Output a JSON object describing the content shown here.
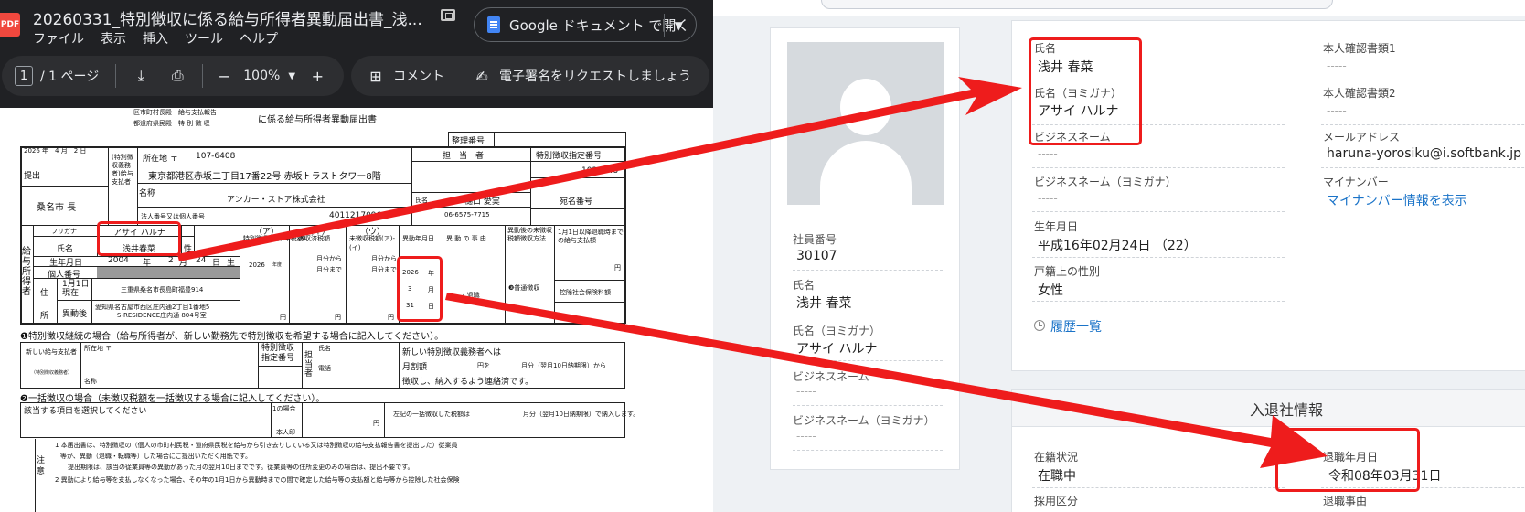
{
  "pdf_viewer": {
    "badge": "PDF",
    "title": "20260331_特別徴収に係る給与所得者異動届出書_浅...",
    "menu": [
      "ファイル",
      "表示",
      "挿入",
      "ツール",
      "ヘルプ"
    ],
    "open_with": "Google ドキュメント で開く",
    "page_current": "1",
    "page_total": "/ 1 ページ",
    "zoom": "100%",
    "comment": "コメント",
    "esign": "電子署名をリクエストしましょう"
  },
  "pdf_form": {
    "header_line1": "区市町村長殿　給与支払報告",
    "header_line2": "都道府県民殿　特 別 徴 収",
    "header_title": "に係る給与所得者異動届出書",
    "seiri_bango": "整理番号",
    "date_line": "2026 年　4 月　2 日",
    "teishutsu": "提出",
    "obligor_label": "(特別徴収義務者)給与支払者",
    "address_label": "所在地 〒",
    "postal": "107-6408",
    "address": "東京都港区赤坂二丁目17番22号 赤坂トラストタワー8階",
    "name_label": "名称",
    "company": "アンカー・ストア株式会社",
    "mayor": "桑名市 長",
    "corp_no_label": "法人番号又は個人番号",
    "corp_no": "4011217096",
    "tanto_label": "担　当　者",
    "shitei_label": "特別徴収指定番号",
    "shitei_no": "1027348",
    "tanto_name_label": "氏名",
    "tanto_name": "樋口 愛実",
    "atena_label": "宛名番号",
    "phone": "06-6575-7715",
    "furigana_label": "フリガナ",
    "furigana": "アサイ ハルナ",
    "shimei_label": "氏名",
    "shimei": "浅井春菜",
    "sex": "性",
    "birth_label": "生年月日",
    "birth_year": "2004",
    "birth_month": "2",
    "birth_day": "24",
    "nen": "年",
    "gatsu": "月",
    "nichi": "日",
    "sei": "生",
    "kojin_label": "個人番号",
    "jan1_label": "1月1日現在",
    "jan1_addr": "三重県桑名市長島町福豊914",
    "ido_label": "異動後",
    "ido_addr1": "愛知県名古屋市西区庄内通2丁目1番地5",
    "ido_addr2": "S-RESIDENCE庄内通 804号室",
    "ju": "住",
    "sho": "所",
    "kyuyo_label": "給与所得者",
    "col_a": "（ア）",
    "col_a_text": "特別徴収税額(年税額)",
    "col_i": "（イ）",
    "col_i_text": "徴収済税額",
    "col_u": "（ウ）",
    "col_u_text": "未徴収税額(ア)-(イ)",
    "ido_ymd_label": "異動年月日",
    "ido_jiyu_label": "異 動 の 事 由",
    "ido_go_label": "異動後の未徴収税額徴収方法",
    "jan1_after_label": "1月1日以降退職時までの給与支払額",
    "year_2026": "2026",
    "nendo": "年度",
    "tsuki_kara": "月分から",
    "tsuki_made": "月分まで",
    "ido_year": "2026",
    "ido_month": "3",
    "ido_day": "31",
    "taishoku": "2 退職",
    "futsu": "❸普通徴収",
    "en": "円",
    "koujo_label": "控除社会保険料額",
    "sec1_title": "❶特別徴収継続の場合（給与所得者が、新しい勤務先で特別徴収を希望する場合に記入してください）。",
    "new_payer": "新しい給与支払者",
    "new_payer_sub": "（特別徴収義務者）",
    "shozaichi": "所在地 〒",
    "meisho": "名称",
    "sp_no_label": "特別徴収指定番号",
    "tanto_short": "担当者",
    "shimei_short": "氏名",
    "denwa": "電話",
    "new_obl_text": "新しい特別徴収義務者へは",
    "tsuki_wari": "月割額",
    "en_wo": "円を",
    "tsuki_bun": "月分（翌月10日納期限）から",
    "choushu_text": "徴収し、納入するよう連絡済です。",
    "sec2_title": "❷一括徴収の場合（未徴収税額を一括徴収する場合に記入してください）。",
    "gaitou": "該当する項目を選択してください",
    "ichigatsu_case": "1の場合",
    "honnin": "本人印",
    "ikkatsu_text": "左記の一括徴収した税額は",
    "nounyu_text": "月分（翌月10日納期限）で納入します。",
    "note_label": "注意",
    "note1": "1 本届出書は、特別徴収の（個人の市町村民税・道府県民税を給与から引き去りしている又は特別徴収の給与支払報告書を提出した）従業員",
    "note1b": "等が、異動（退職・転職等）した場合にご提出いただく用紙です。",
    "note1c": "提出期限は、該当の従業員等の異動があった月の翌月10日までです。従業員等の住所変更のみの場合は、提出不要です。",
    "note2": "2 異動により給与等を支払しなくなった場合、その年の1月1日から異動時までの間で確定した給与等の支払額と給与等から控除した社会保険"
  },
  "profile_card": {
    "employee_no_label": "社員番号",
    "employee_no": "30107",
    "name_label": "氏名",
    "name": "浅井 春菜",
    "kana_label": "氏名（ヨミガナ）",
    "kana": "アサイ ハルナ",
    "business_name_label": "ビジネスネーム",
    "business_name": "-----",
    "business_kana_label": "ビジネスネーム（ヨミガナ）",
    "business_kana": "-----"
  },
  "info_card": {
    "name_label": "氏名",
    "name": "浅井 春菜",
    "kana_label": "氏名（ヨミガナ）",
    "kana": "アサイ ハルナ",
    "business_name_label": "ビジネスネーム",
    "business_name": "-----",
    "business_kana_label": "ビジネスネーム（ヨミガナ）",
    "business_kana": "-----",
    "birth_label": "生年月日",
    "birth": "平成16年02月24日 （22）",
    "sex_label": "戸籍上の性別",
    "sex": "女性",
    "history_link": "履歴一覧",
    "id_doc1_label": "本人確認書類1",
    "id_doc1": "-----",
    "id_doc2_label": "本人確認書類2",
    "id_doc2": "-----",
    "email_label": "メールアドレス",
    "email": "haruna-yorosiku@i.softbank.jp",
    "mynumber_label": "マイナンバー",
    "mynumber_link": "マイナンバー情報を表示"
  },
  "join_card": {
    "title": "入退社情報",
    "status_label": "在籍状況",
    "status": "在職中",
    "hire_type_label": "採用区分",
    "retire_date_label": "退職年月日",
    "retire_date": "令和08年03月31日",
    "retire_reason_label": "退職事由"
  },
  "colors": {
    "annotation_red": "#ee1c1c",
    "viewer_dark": "#202124",
    "link_blue": "#1a73c8"
  }
}
